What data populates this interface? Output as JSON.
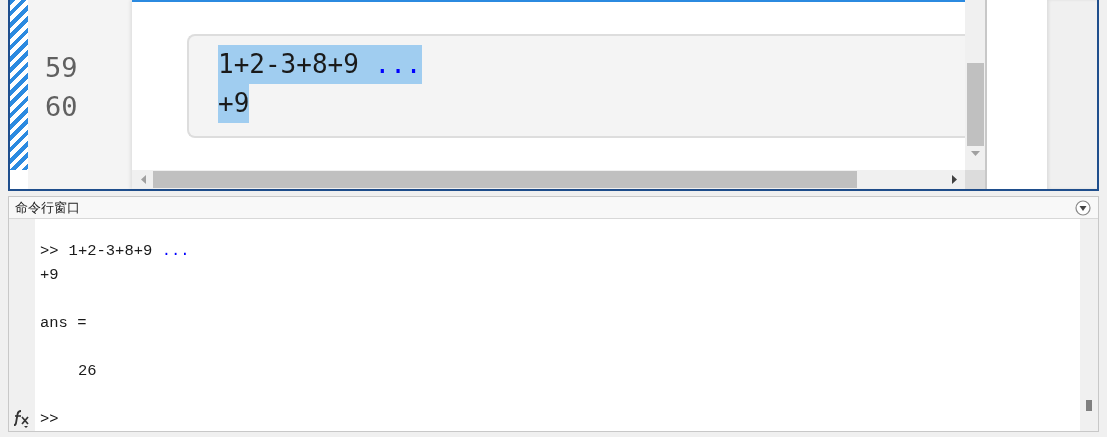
{
  "editor": {
    "lines": [
      {
        "number": "59",
        "selected": true,
        "segments": [
          {
            "kind": "code",
            "text": "1+2-3+8+9 "
          },
          {
            "kind": "continuation",
            "text": "..."
          }
        ]
      },
      {
        "number": "60",
        "selected": true,
        "segments": [
          {
            "kind": "code",
            "text": "+9"
          }
        ]
      }
    ]
  },
  "command_window": {
    "title": "命令行窗口",
    "lines": [
      {
        "kind": "input",
        "prompt": ">>",
        "segments": [
          {
            "kind": "code",
            "text": "1+2-3+8+9 "
          },
          {
            "kind": "continuation",
            "text": "..."
          }
        ]
      },
      {
        "kind": "input_continued",
        "segments": [
          {
            "kind": "code",
            "text": "+9"
          }
        ]
      },
      {
        "kind": "result_name",
        "segments": [
          {
            "kind": "code",
            "text": "ans ="
          }
        ]
      },
      {
        "kind": "result_value",
        "segments": [
          {
            "kind": "code",
            "text": "26"
          }
        ]
      }
    ],
    "prompt": ">>"
  }
}
